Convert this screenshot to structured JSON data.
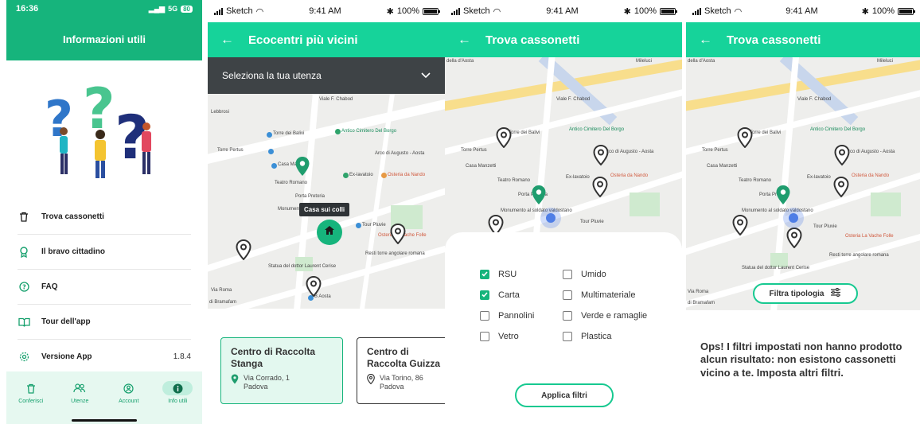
{
  "colors": {
    "brand": "#16b47c",
    "brand_light": "#16d39a",
    "pin": "#3a3a3a",
    "pin_active": "#1f9d6e"
  },
  "screen1": {
    "status": {
      "time": "16:36",
      "network": "5G",
      "battery": "80"
    },
    "title": "Informazioni utili",
    "menu": [
      {
        "icon": "trash-icon",
        "label": "Trova cassonetti"
      },
      {
        "icon": "medal-icon",
        "label": "Il bravo cittadino"
      },
      {
        "icon": "help-circle-icon",
        "label": "FAQ"
      },
      {
        "icon": "book-icon",
        "label": "Tour dell'app"
      },
      {
        "icon": "gear-icon",
        "label": "Versione App",
        "value": "1.8.4"
      }
    ],
    "tabs": [
      {
        "icon": "trash-icon",
        "label": "Conferisci"
      },
      {
        "icon": "users-icon",
        "label": "Utenze"
      },
      {
        "icon": "account-icon",
        "label": "Account"
      },
      {
        "icon": "info-icon",
        "label": "Info utili",
        "active": true
      }
    ]
  },
  "ios_status": {
    "carrier": "Sketch",
    "time": "9:41 AM",
    "battery": "100%"
  },
  "screen2": {
    "title": "Ecocentri più vicini",
    "select_label": "Seleziona la tua utenza",
    "tooltip": "Casa sui colli",
    "cards": [
      {
        "title": "Centro di Raccolta Stanga",
        "address_line1": "Via Corrado, 1",
        "address_line2": "Padova"
      },
      {
        "title": "Centro di Raccolta Guizza",
        "address_line1": "Via Torino, 86",
        "address_line2": "Padova"
      }
    ]
  },
  "screen3": {
    "title": "Trova cassonetti",
    "filters": [
      {
        "label": "RSU",
        "checked": true
      },
      {
        "label": "Umido",
        "checked": false
      },
      {
        "label": "Carta",
        "checked": true
      },
      {
        "label": "Multimateriale",
        "checked": false
      },
      {
        "label": "Pannolini",
        "checked": false
      },
      {
        "label": "Verde e ramaglie",
        "checked": false
      },
      {
        "label": "Vetro",
        "checked": false
      },
      {
        "label": "Plastica",
        "checked": false
      }
    ],
    "apply_label": "Applica filtri"
  },
  "screen4": {
    "title": "Trova cassonetti",
    "filter_button": "Filtra tipologia",
    "message": "Ops! I filtri impostati non hanno prodotto alcun risultato: non esistono cassonetti vicino a te. Imposta altri filtri."
  },
  "map_labels": {
    "torre_balivi": "Torre dei Balivi",
    "cimitero": "Antico Cimitero Del Borgo",
    "torre_pertus": "Torre Pertus",
    "arco": "Arco di Augusto - Aosta",
    "casa_manzetti": "Casa Manzetti",
    "ex_lavatoio": "Ex-lavatoio",
    "osteria_nando": "Osteria da Nando",
    "teatro_romano": "Teatro Romano",
    "porta_pretoria": "Porta Pretoria",
    "monumento": "Monumento al soldato valdostano",
    "tour_pluvie": "Tour Pluvie",
    "osteria_vache": "Osteria La Vache Folle",
    "resti_torre": "Resti torre angolare romana",
    "statua": "Statua del dottor Laurent Cerise",
    "aosta": "B Aosta",
    "viale_chabod": "Viale F. Chabod",
    "via_roma": "Via Roma",
    "bramafam": "di Bramafam",
    "lebbrosi": "Lebbrosi",
    "mileluci": "Mileluci",
    "aosta_top": "della d'Aosta"
  }
}
